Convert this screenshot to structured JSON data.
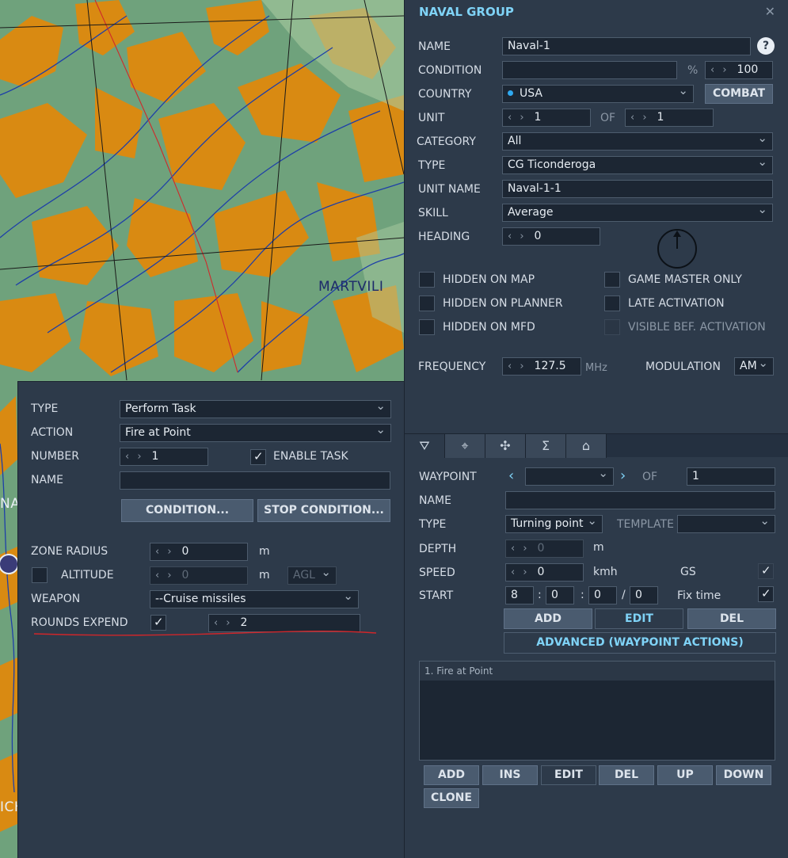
{
  "map": {
    "town_label": "MARTVILI",
    "edge_labels": [
      "NA",
      "ICH"
    ],
    "colors": {
      "land": "#6fa27c",
      "forest": "#d98a12",
      "river": "#1e3fa8",
      "road": "#cf2a2a",
      "grid": "#1a1a1a"
    }
  },
  "group": {
    "title": "NAVAL GROUP",
    "close_icon": "close-icon",
    "name_label": "NAME",
    "name_value": "Naval-1",
    "help": "?",
    "condition_label": "CONDITION",
    "condition_value": "",
    "percent": "%",
    "condition_pct": "100",
    "country_label": "COUNTRY",
    "country_value": "USA",
    "combat_button": "COMBAT",
    "unit_label": "UNIT",
    "unit_value": "1",
    "of_label": "OF",
    "unit_total": "1",
    "category_label": "CATEGORY",
    "category_value": "All",
    "type_label": "TYPE",
    "type_value": "CG Ticonderoga",
    "unit_name_label": "UNIT NAME",
    "unit_name_value": "Naval-1-1",
    "skill_label": "SKILL",
    "skill_value": "Average",
    "heading_label": "HEADING",
    "heading_value": "0",
    "checks": {
      "hidden_on_map": "HIDDEN ON MAP",
      "hidden_on_planner": "HIDDEN ON PLANNER",
      "hidden_on_mfd": "HIDDEN ON MFD",
      "game_master_only": "GAME MASTER ONLY",
      "late_activation": "LATE ACTIVATION",
      "visible_bef_activation": "VISIBLE BEF. ACTIVATION"
    },
    "frequency_label": "FREQUENCY",
    "frequency_value": "127.5",
    "mhz": "MHz",
    "modulation_label": "MODULATION",
    "modulation_value": "AM"
  },
  "tabs": [
    "route-icon",
    "target-icon",
    "payload-icon",
    "summary-icon",
    "hangar-icon"
  ],
  "waypoint": {
    "waypoint_label": "WAYPOINT",
    "of_label": "OF",
    "total": "1",
    "name_label": "NAME",
    "name_value": "",
    "type_label": "TYPE",
    "type_value": "Turning point",
    "template_label": "TEMPLATE",
    "template_value": "",
    "depth_label": "DEPTH",
    "depth_value": "0",
    "depth_unit": "m",
    "speed_label": "SPEED",
    "speed_value": "0",
    "speed_unit": "kmh",
    "gs_label": "GS",
    "start_label": "START",
    "start_h": "8",
    "start_m": "0",
    "start_s": "0",
    "start_d": "0",
    "colon": ":",
    "slash": "/",
    "fix_time_label": "Fix time",
    "add": "ADD",
    "edit": "EDIT",
    "del": "DEL",
    "advanced": "ADVANCED (WAYPOINT ACTIONS)",
    "actions": [
      "1. Fire at Point"
    ],
    "list_buttons": {
      "add": "ADD",
      "ins": "INS",
      "edit": "EDIT",
      "del": "DEL",
      "up": "UP",
      "down": "DOWN",
      "clone": "CLONE"
    }
  },
  "task": {
    "type_label": "TYPE",
    "type_value": "Perform Task",
    "action_label": "ACTION",
    "action_value": "Fire at Point",
    "number_label": "NUMBER",
    "number_value": "1",
    "enable_task": "ENABLE TASK",
    "name_label": "NAME",
    "name_value": "",
    "condition_button": "CONDITION...",
    "stop_condition_button": "STOP CONDITION...",
    "zone_radius_label": "ZONE RADIUS",
    "zone_radius_value": "0",
    "unit_m": "m",
    "altitude_label": "ALTITUDE",
    "altitude_value": "0",
    "altitude_ref": "AGL",
    "weapon_label": "WEAPON",
    "weapon_value": "--Cruise missiles",
    "rounds_expend_label": "ROUNDS EXPEND",
    "rounds_value": "2"
  }
}
